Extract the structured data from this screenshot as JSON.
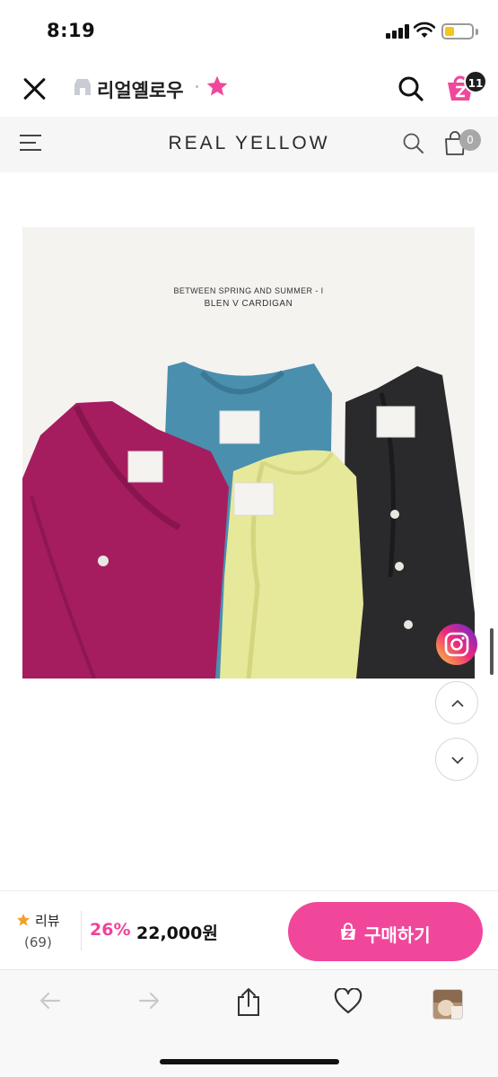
{
  "status_bar": {
    "time": "8:19"
  },
  "app_bar": {
    "store_name": "리얼옐로우",
    "cart_count": "11"
  },
  "shop_header": {
    "brand": "REAL YELLOW",
    "bag_count": "0"
  },
  "product_image": {
    "caption_line1": "BETWEEN SPRING AND SUMMER - I",
    "caption_line2": "BLEN V CARDIGAN",
    "colors": [
      "#a51d5f",
      "#4a8fae",
      "#e6e89a",
      "#2a2a2c"
    ]
  },
  "purchase_bar": {
    "review_label": "리뷰",
    "review_count": "(69)",
    "discount": "26%",
    "price": "22,000원",
    "buy_label": "구매하기",
    "accent_color": "#f1479b"
  },
  "icons": [
    "close-icon",
    "store-icon",
    "star-icon",
    "search-icon",
    "z-cart-icon",
    "hamburger-icon",
    "bag-icon",
    "instagram-icon",
    "chevron-up-icon",
    "chevron-down-icon",
    "back-arrow-icon",
    "forward-arrow-icon",
    "share-icon",
    "heart-icon"
  ]
}
